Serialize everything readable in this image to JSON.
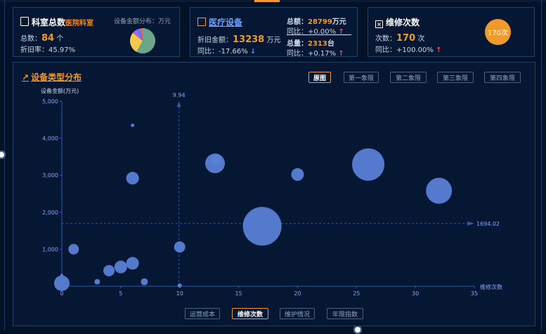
{
  "header_cards": {
    "dept_total": {
      "title": "科室总数",
      "subtitle": "医院科室",
      "total_label": "总数：",
      "total_value": "84",
      "total_unit": "个",
      "depr_rate_label": "折旧率：45.97%",
      "dist_label": "设备金额分布：万元"
    },
    "medical_equipment": {
      "title": "医疗设备",
      "depr_amount_label": "折旧金额：",
      "depr_amount_value": "13238",
      "depr_amount_unit": "万元",
      "yoy_label": "同比：-17.66%",
      "total_amount_label": "总额：",
      "total_amount_value": "28799",
      "total_amount_unit": "万元",
      "total_amount_yoy": "同比：+0.00%",
      "total_qty_label": "总量：",
      "total_qty_value": "2313",
      "total_qty_unit": "台",
      "total_qty_yoy": "同比：+0.17%"
    },
    "repairs": {
      "title": "维修次数",
      "count_label": "次数：",
      "count_value": "170",
      "count_unit": "次",
      "yoy_label": "同比：+100.00%",
      "badge": "170次"
    }
  },
  "main": {
    "title": "设备类型分布",
    "tabs_top": [
      "原图",
      "第一象限",
      "第二象限",
      "第三象限",
      "第四象限"
    ],
    "tabs_bottom": [
      "运营成本",
      "维修次数",
      "维护情况",
      "年限指数"
    ],
    "y_axis_name": "设备金额(万元)",
    "x_axis_name": "维修次数"
  },
  "colors": {
    "accent": "#f09a2b",
    "bubble": "#5a7fd6",
    "background": "#041228",
    "up": "#f04b5b",
    "down": "#4f8bff"
  },
  "pie_chart": {
    "type": "pie",
    "slices": [
      {
        "name": "slice-1",
        "value": 58,
        "color": "#6aa58a"
      },
      {
        "name": "slice-2",
        "value": 28,
        "color": "#f2c94c"
      },
      {
        "name": "slice-3",
        "value": 6,
        "color": "#a26be0"
      },
      {
        "name": "slice-4",
        "value": 5,
        "color": "#5b7cff"
      },
      {
        "name": "slice-5",
        "value": 3,
        "color": "#e06666"
      }
    ]
  },
  "chart_data": {
    "type": "scatter",
    "xlim": [
      0,
      35
    ],
    "ylim": [
      0,
      5000
    ],
    "x_ticks": [
      0,
      5,
      10,
      15,
      20,
      25,
      30,
      35
    ],
    "y_ticks": [
      "0",
      "1,000",
      "2,000",
      "3,000",
      "4,000",
      "5,000"
    ],
    "mark_x_label": "9.94",
    "mark_y_label": "1694.02",
    "mark_x": 9.94,
    "mark_y": 1694.02,
    "points": [
      {
        "x": 0,
        "y": 80,
        "size": 22
      },
      {
        "x": 0,
        "y": 300,
        "size": 4
      },
      {
        "x": 1,
        "y": 1000,
        "size": 15
      },
      {
        "x": 3,
        "y": 120,
        "size": 8
      },
      {
        "x": 4,
        "y": 420,
        "size": 16
      },
      {
        "x": 5,
        "y": 520,
        "size": 18
      },
      {
        "x": 6,
        "y": 620,
        "size": 18
      },
      {
        "x": 7,
        "y": 120,
        "size": 10
      },
      {
        "x": 6,
        "y": 2920,
        "size": 18
      },
      {
        "x": 6,
        "y": 4350,
        "size": 5
      },
      {
        "x": 10,
        "y": 1060,
        "size": 16
      },
      {
        "x": 10,
        "y": 20,
        "size": 6
      },
      {
        "x": 13,
        "y": 3320,
        "size": 28
      },
      {
        "x": 13.1,
        "y": 3420,
        "size": 16
      },
      {
        "x": 17,
        "y": 1620,
        "size": 55
      },
      {
        "x": 20,
        "y": 3020,
        "size": 18
      },
      {
        "x": 26,
        "y": 3290,
        "size": 46
      },
      {
        "x": 32,
        "y": 2580,
        "size": 37
      }
    ]
  }
}
